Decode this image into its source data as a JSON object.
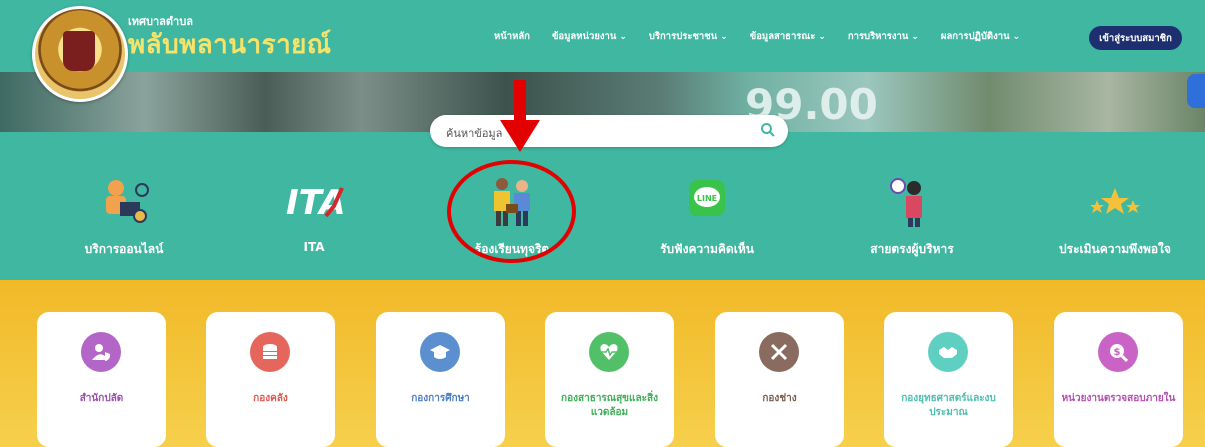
{
  "brand": {
    "subtitle": "เทศบาลตำบล",
    "title": "พลับพลานารายณ์"
  },
  "nav": {
    "items": [
      {
        "label": "หน้าหลัก",
        "dropdown": false
      },
      {
        "label": "ข้อมูลหน่วยงาน",
        "dropdown": true
      },
      {
        "label": "บริการประชาชน",
        "dropdown": true
      },
      {
        "label": "ข้อมูลสาธารณะ",
        "dropdown": true
      },
      {
        "label": "การบริหารงาน",
        "dropdown": true
      },
      {
        "label": "ผลการปฏิบัติงาน",
        "dropdown": true
      }
    ],
    "member_button": "เข้าสู่ระบบสมาชิก"
  },
  "banner": {
    "number_text": "99.00"
  },
  "search": {
    "placeholder": "ค้นหาข้อมูล"
  },
  "quick_links": [
    {
      "label": "บริการออนไลน์",
      "icon": "online-service-icon"
    },
    {
      "label": "ITA",
      "icon": "ita-logo-icon"
    },
    {
      "label": "ร้องเรียนทุจริต",
      "icon": "corruption-complaint-icon"
    },
    {
      "label": "รับฟังความคิดเห็น",
      "icon": "line-chat-icon"
    },
    {
      "label": "สายตรงผู้บริหาร",
      "icon": "executive-hotline-icon"
    },
    {
      "label": "ประเมินความพึงพอใจ",
      "icon": "satisfaction-stars-icon"
    }
  ],
  "departments": [
    {
      "label": "สำนักปลัด",
      "color": "#b466c8",
      "text_color": "#9b4fb0",
      "icon": "user-shield-icon"
    },
    {
      "label": "กองคลัง",
      "color": "#e5665c",
      "text_color": "#e0574c",
      "icon": "coins-icon"
    },
    {
      "label": "กองการศึกษา",
      "color": "#5b8fd0",
      "text_color": "#4f7fc2",
      "icon": "graduation-cap-icon"
    },
    {
      "label": "กองสาธารณสุขและสิ่งแวดล้อม",
      "color": "#52bf69",
      "text_color": "#3fae57",
      "icon": "heartbeat-icon"
    },
    {
      "label": "กองช่าง",
      "color": "#8a6b5f",
      "text_color": "#7a5c50",
      "icon": "tools-icon"
    },
    {
      "label": "กองยุทธศาสตร์และงบประมาณ",
      "color": "#5fcfc1",
      "text_color": "#4dbfb0",
      "icon": "handshake-icon"
    },
    {
      "label": "หน่วยงานตรวจสอบภายใน",
      "color": "#c964c6",
      "text_color": "#b64fb3",
      "icon": "dollar-search-icon"
    }
  ]
}
